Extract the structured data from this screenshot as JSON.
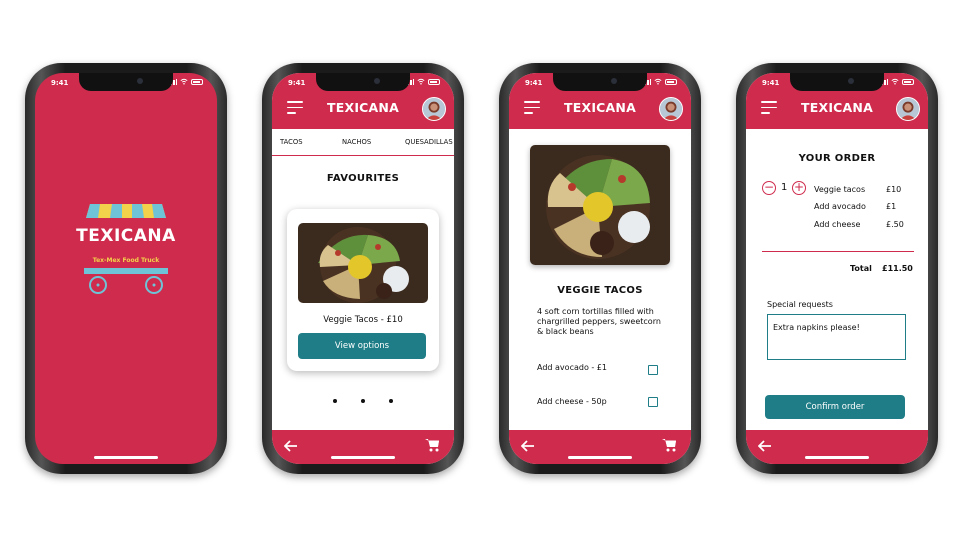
{
  "status_time": "9:41",
  "brand": "TEXICANA",
  "colors": {
    "brand_red": "#cf2b4d",
    "teal": "#1e7d86",
    "awning_yellow": "#f2d24a",
    "awning_blue": "#6fc3d6"
  },
  "splash": {
    "logo_text": "TEXICANA",
    "tagline": "Tex-Mex Food Truck"
  },
  "menu": {
    "tabs": [
      "TACOS",
      "NACHOS",
      "QUESADILLAS"
    ],
    "section_title": "FAVOURITES",
    "item_name": "Veggie Tacos  -  £10",
    "button": "View options"
  },
  "detail": {
    "title": "VEGGIE TACOS",
    "description": "4 soft corn tortillas filled with chargrilled peppers, sweetcorn & black beans",
    "options": [
      {
        "label": "Add avocado -  £1"
      },
      {
        "label": "Add cheese -  50p"
      }
    ]
  },
  "order": {
    "title": "YOUR ORDER",
    "quantity": "1",
    "items": [
      {
        "name": "Veggie tacos",
        "price": "£10"
      },
      {
        "name": "Add avocado",
        "price": "£1"
      },
      {
        "name": "Add cheese",
        "price": "£.50"
      }
    ],
    "total_label": "Total",
    "total_value": "£11.50",
    "requests_label": "Special requests",
    "requests_value": "Extra napkins please!",
    "confirm": "Confirm order"
  },
  "icons": [
    "menu-icon",
    "avatar",
    "back-arrow-icon",
    "cart-icon",
    "minus-icon",
    "plus-icon",
    "checkbox"
  ]
}
